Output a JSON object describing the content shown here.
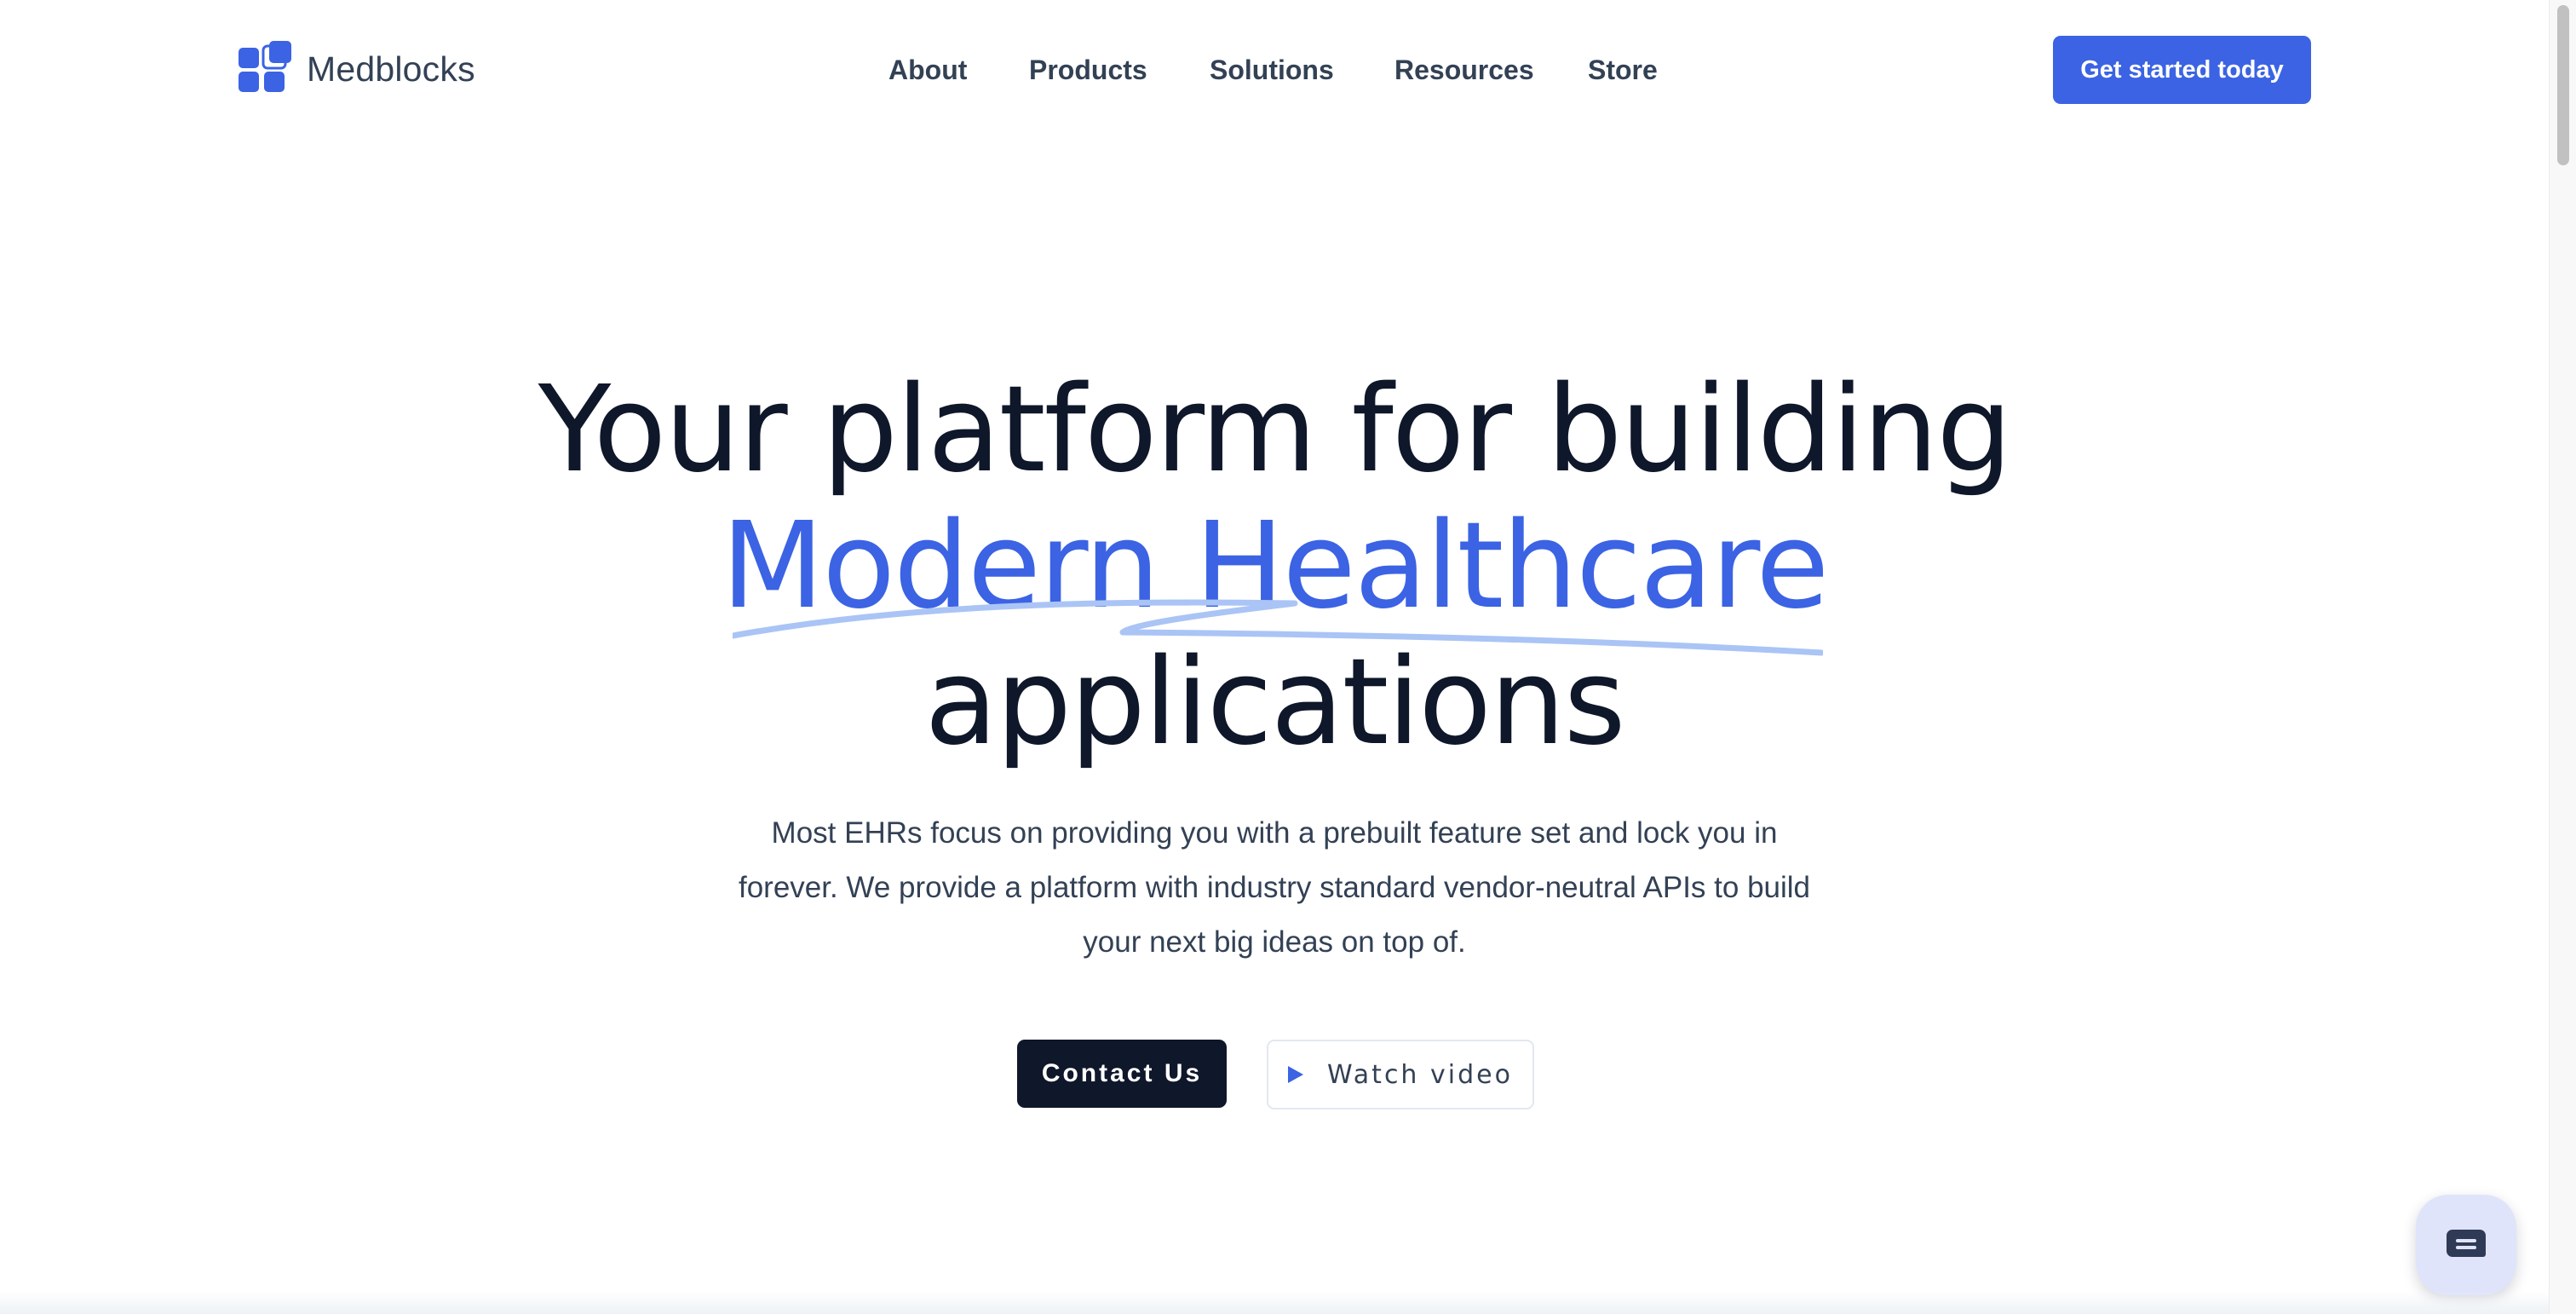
{
  "brand": {
    "name": "Medblocks",
    "accent_color": "#3b63e3",
    "dark_color": "#0f172a"
  },
  "nav": {
    "items": [
      {
        "label": "About"
      },
      {
        "label": "Products"
      },
      {
        "label": "Solutions"
      },
      {
        "label": "Resources"
      },
      {
        "label": "Store"
      }
    ],
    "cta_label": "Get started today"
  },
  "hero": {
    "line1": "Your platform for building",
    "line2": "Modern Healthcare",
    "line3": "applications",
    "subcopy": "Most EHRs focus on providing you with a prebuilt feature set and lock you in forever. We provide a platform with industry standard vendor-neutral APIs to build your next big ideas on top of.",
    "contact_label": "Contact Us",
    "video_label": "Watch video",
    "video_icon": "play-icon"
  },
  "chat": {
    "icon": "chat-bubble-icon"
  }
}
